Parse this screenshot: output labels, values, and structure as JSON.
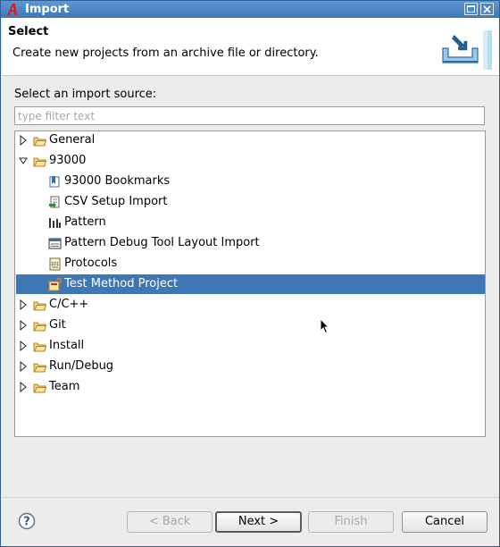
{
  "window": {
    "title": "Import"
  },
  "header": {
    "title": "Select",
    "description": "Create new projects from an archive file or directory."
  },
  "source_label": "Select an import source:",
  "filter": {
    "placeholder": "type filter text",
    "value": ""
  },
  "tree": [
    {
      "label": "General",
      "kind": "folder",
      "expanded": false,
      "level": 0
    },
    {
      "label": "93000",
      "kind": "folder",
      "expanded": true,
      "level": 0
    },
    {
      "label": "93000 Bookmarks",
      "kind": "bookmarks-icon",
      "level": 1
    },
    {
      "label": "CSV Setup Import",
      "kind": "csv-import-icon",
      "level": 1
    },
    {
      "label": "Pattern",
      "kind": "pattern-icon",
      "level": 1
    },
    {
      "label": "Pattern Debug Tool Layout Import",
      "kind": "layout-import-icon",
      "level": 1
    },
    {
      "label": "Protocols",
      "kind": "protocols-icon",
      "level": 1
    },
    {
      "label": "Test Method Project",
      "kind": "test-method-icon",
      "level": 1,
      "selected": true
    },
    {
      "label": "C/C++",
      "kind": "folder",
      "expanded": false,
      "level": 0
    },
    {
      "label": "Git",
      "kind": "folder",
      "expanded": false,
      "level": 0
    },
    {
      "label": "Install",
      "kind": "folder",
      "expanded": false,
      "level": 0
    },
    {
      "label": "Run/Debug",
      "kind": "folder",
      "expanded": false,
      "level": 0
    },
    {
      "label": "Team",
      "kind": "folder",
      "expanded": false,
      "level": 0
    }
  ],
  "buttons": {
    "back": "< Back",
    "next": "Next >",
    "finish": "Finish",
    "cancel": "Cancel"
  },
  "colors": {
    "titlebar": "#3c78b8",
    "selection": "#3f77b5"
  }
}
